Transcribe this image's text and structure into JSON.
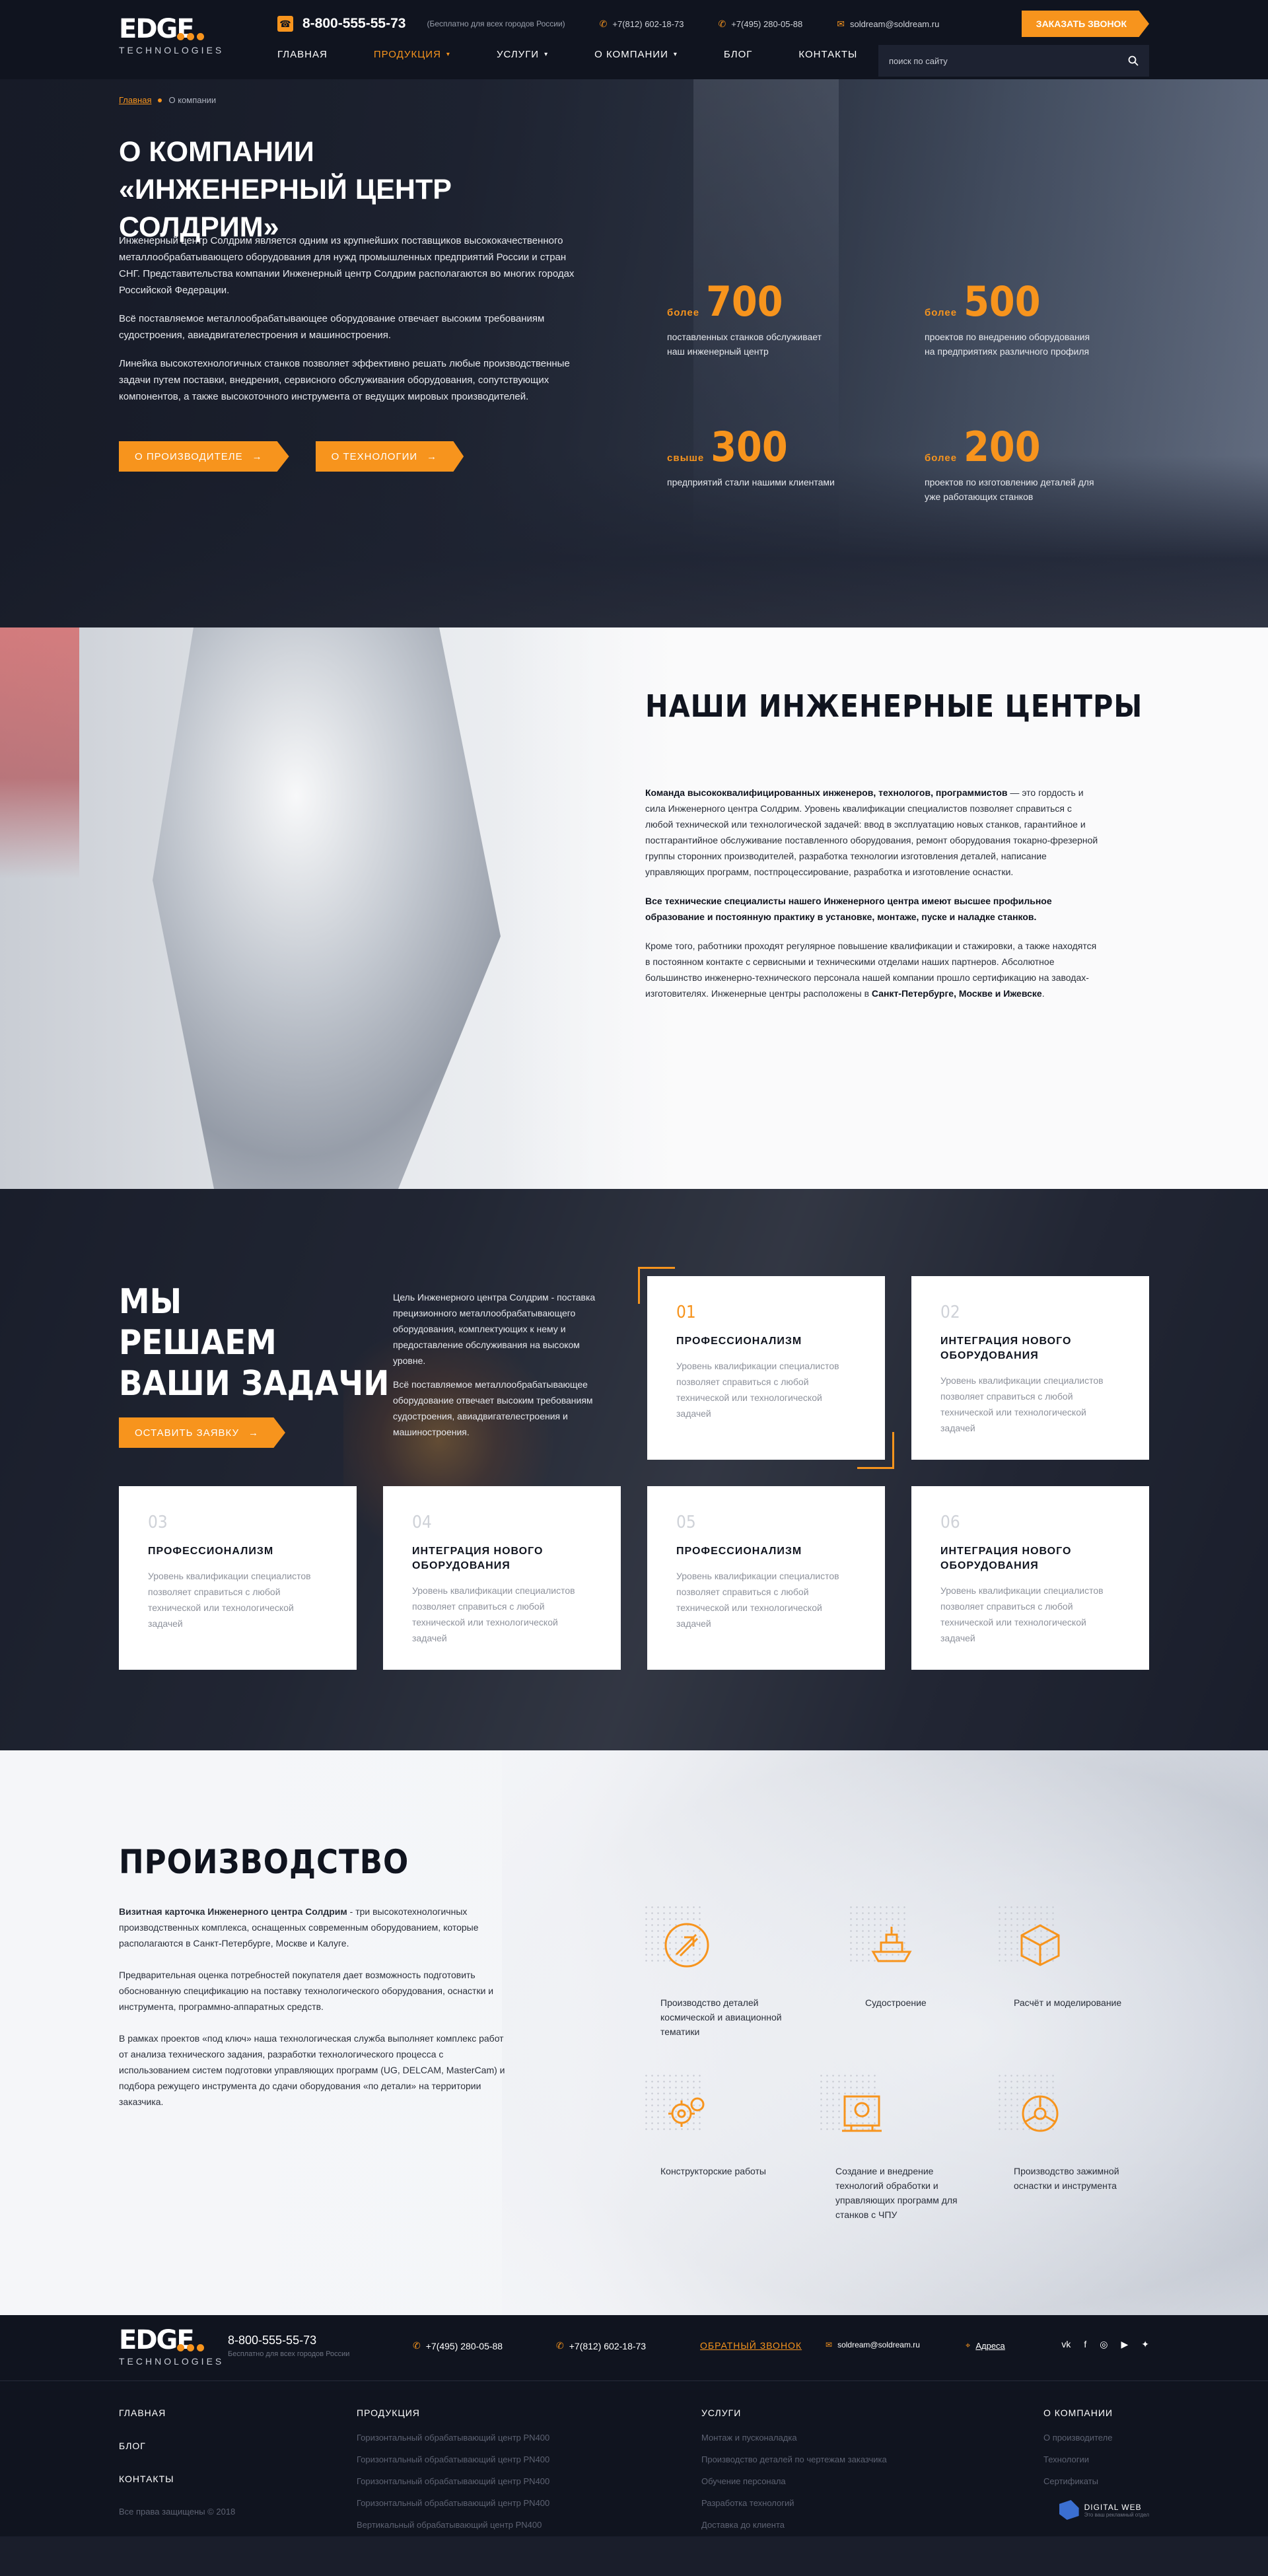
{
  "header": {
    "logo_main": "EDGE",
    "logo_sub": "TECHNOLOGIES",
    "phone": "8-800-555-55-73",
    "phone_note": "(Бесплатно для всех городов России)",
    "phone_spb": "+7(812) 602-18-73",
    "phone_msk": "+7(495) 280-05-88",
    "email": "soldream@soldream.ru",
    "order_button": "ЗАКАЗАТЬ ЗВОНОК",
    "nav": [
      "ГЛАВНАЯ",
      "ПРОДУКЦИЯ",
      "УСЛУГИ",
      "О КОМПАНИИ",
      "БЛОГ",
      "КОНТАКТЫ"
    ],
    "search_placeholder": "поиск по сайту"
  },
  "hero": {
    "breadcrumb_home": "Главная",
    "breadcrumb_current": "О компании",
    "title": "О КОМПАНИИ «ИНЖЕНЕРНЫЙ ЦЕНТР СОЛДРИМ»",
    "paragraphs": [
      "Инженерный центр Солдрим является одним из крупнейших поставщиков высококачественного металлообрабатывающего оборудования для нужд промышленных предприятий России и стран СНГ. Представительства компании Инженерный центр Солдрим располагаются во многих городах Российской Федерации.",
      "Всё поставляемое металлообрабатывающее оборудование отвечает высоким требованиям судостроения, авиадвигателестроения и машиностроения.",
      "Линейка высокотехнологичных станков позволяет эффективно решать любые производственные задачи путем поставки, внедрения, сервисного обслуживания оборудования, сопутствующих компонентов, а также высокоточного инструмента от ведущих мировых производителей."
    ],
    "btn_manufacturer": "О ПРОИЗВОДИТЕЛЕ",
    "btn_technology": "О ТЕХНОЛОГИИ",
    "stats": [
      {
        "pre": "более",
        "value": "700",
        "desc": "поставленных станков обслуживает наш инженерный центр"
      },
      {
        "pre": "более",
        "value": "500",
        "desc": "проектов по внедрению оборудования на предприятиях различного профиля"
      },
      {
        "pre": "свыше",
        "value": "300",
        "desc": "предприятий стали нашими клиентами"
      },
      {
        "pre": "более",
        "value": "200",
        "desc": "проектов по изготовлению деталей для уже работающих станков"
      }
    ]
  },
  "eng": {
    "title": "НАШИ ИНЖЕНЕРНЫЕ ЦЕНТРЫ",
    "p1_bold": "Команда высококвалифицированных инженеров, технологов, программистов",
    "p1_rest": " — это гордость и сила Инженерного центра Солдрим. Уровень квалификации специалистов позволяет справиться с любой технической или технологической задачей: ввод в эксплуатацию новых станков, гарантийное и постгарантийное обслуживание поставленного оборудования, ремонт оборудования токарно-фрезерной группы сторонних производителей, разработка технологии изготовления деталей, написание управляющих программ, постпроцессирование, разработка и изготовление оснастки.",
    "p2": "Все технические специалисты нашего Инженерного центра имеют высшее профильное образование и постоянную практику в установке, монтаже, пуске и наладке станков.",
    "p3_start": "Кроме того, работники проходят регулярное повышение квалификации и стажировки, а также находятся в постоянном контакте с сервисными и техническими отделами наших партнеров. Абсолютное большинство инженерно-технического персонала нашей компании прошло сертификацию на заводах-изготовителях. Инженерные центры расположены в ",
    "p3_bold": "Санкт-Петербурге, Москве и Ижевске",
    "p3_end": "."
  },
  "solve": {
    "title_lines": [
      "МЫ",
      "РЕШАЕМ",
      "ВАШИ ЗАДАЧИ"
    ],
    "btn": "ОСТАВИТЬ ЗАЯВКУ",
    "p1": "Цель Инженерного центра Солдрим - поставка прецизионного металлообрабатывающего оборудования, комплектующих к нему и предоставление обслуживания на высоком уровне.",
    "p2": "Всё поставляемое металлообрабатывающее оборудование отвечает высоким требованиям судостроения, авиадвигателестроения и машиностроения.",
    "cards": [
      {
        "n": "01",
        "t": "ПРОФЕССИОНАЛИЗМ",
        "d": "Уровень квалификации специалистов позволяет справиться с любой технической или технологической задачей"
      },
      {
        "n": "02",
        "t": "ИНТЕГРАЦИЯ НОВОГО ОБОРУДОВАНИЯ",
        "d": "Уровень квалификации специалистов позволяет справиться с любой технической или технологической задачей"
      },
      {
        "n": "03",
        "t": "ПРОФЕССИОНАЛИЗМ",
        "d": "Уровень квалификации специалистов позволяет справиться с любой технической или технологической задачей"
      },
      {
        "n": "04",
        "t": "ИНТЕГРАЦИЯ НОВОГО ОБОРУДОВАНИЯ",
        "d": "Уровень квалификации специалистов позволяет справиться с любой технической или технологической задачей"
      },
      {
        "n": "05",
        "t": "ПРОФЕССИОНАЛИЗМ",
        "d": "Уровень квалификации специалистов позволяет справиться с любой технической или технологической задачей"
      },
      {
        "n": "06",
        "t": "ИНТЕГРАЦИЯ НОВОГО ОБОРУДОВАНИЯ",
        "d": "Уровень квалификации специалистов позволяет справиться с любой технической или технологической задачей"
      }
    ]
  },
  "prod": {
    "title": "ПРОИЗВОДСТВО",
    "p1_bold": "Визитная карточка Инженерного центра Солдрим",
    "p1_rest": " - три высокотехнологичных производственных комплекса, оснащенных современным оборудованием, которые располагаются в Санкт-Петербурге, Москве и Калуге.",
    "p2": "Предварительная оценка потребностей покупателя дает возможность подготовить обоснованную спецификацию на поставку технологического оборудования, оснастки и инструмента, программно-аппаратных средств.",
    "p3": "В рамках проектов «под ключ» наша технологическая служба выполняет комплекс работ от анализа технического задания, разработки технологического процесса с использованием систем подготовки управляющих программ (UG, DELCAM, MasterCam) и подбора режущего инструмента до сдачи оборудования «по детали» на территории заказчика.",
    "industries": [
      {
        "icon": "aerospace-icon",
        "label": "Производство деталей космической и авиационной тематики"
      },
      {
        "icon": "ship-icon",
        "label": "Судостроение"
      },
      {
        "icon": "cube-icon",
        "label": "Расчёт и моделирование"
      },
      {
        "icon": "gears-icon",
        "label": "Конструкторские работы"
      },
      {
        "icon": "cnc-icon",
        "label": "Создание и внедрение технологий обработки и управляющих программ для станков с ЧПУ"
      },
      {
        "icon": "chuck-icon",
        "label": "Производство зажимной оснастки и инструмента"
      }
    ]
  },
  "footer": {
    "phone": "8-800-555-55-73",
    "phone_note": "Бесплатно для всех городов России",
    "phone_msk": "+7(495) 280-05-88",
    "phone_spb": "+7(812) 602-18-73",
    "callback": "ОБРАТНЫЙ ЗВОНОК",
    "email": "soldream@soldream.ru",
    "address": "Адреса",
    "menu": [
      "ГЛАВНАЯ",
      "БЛОГ",
      "КОНТАКТЫ"
    ],
    "products_title": "ПРОДУКЦИЯ",
    "products": [
      "Горизонтальный обрабатывающий центр PN400",
      "Горизонтальный обрабатывающий центр PN400",
      "Горизонтальный обрабатывающий центр PN400",
      "Горизонтальный обрабатывающий центр PN400",
      "Вертикальный обрабатывающий центр PN400"
    ],
    "services_title": "УСЛУГИ",
    "services": [
      "Монтаж и пусконаладка",
      "Производство деталей по чертежам заказчика",
      "Обучение персонала",
      "Разработка технологий",
      "Доставка до клиента"
    ],
    "company_title": "О КОМПАНИИ",
    "company": [
      "О производителе",
      "Технологии",
      "Сертификаты"
    ],
    "copyright": "Все права защищены © 2018",
    "dev_name": "DIGITAL WEB",
    "dev_sub": "Это ваш рекламный отдел"
  }
}
